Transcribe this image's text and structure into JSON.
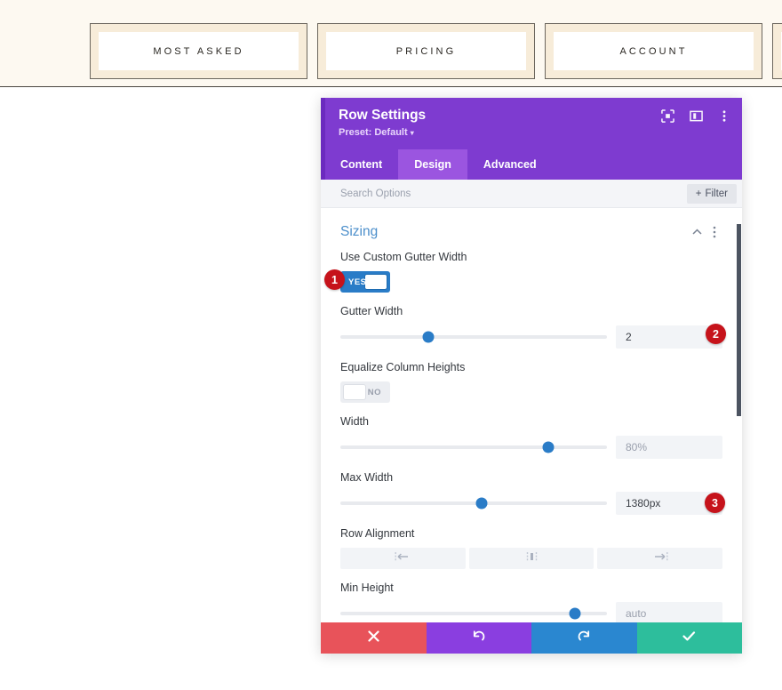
{
  "site": {
    "tabs": [
      {
        "label": "MOST ASKED"
      },
      {
        "label": "PRICING"
      },
      {
        "label": "ACCOUNT"
      },
      {
        "label": ""
      }
    ]
  },
  "modal": {
    "title": "Row Settings",
    "preset_label": "Preset: Default",
    "preset_caret": "▾",
    "header_icons": [
      {
        "name": "focus-target-icon"
      },
      {
        "name": "layout-panel-icon"
      },
      {
        "name": "more-vertical-icon"
      }
    ],
    "tabs": [
      {
        "label": "Content",
        "active": false
      },
      {
        "label": "Design",
        "active": true
      },
      {
        "label": "Advanced",
        "active": false
      }
    ],
    "search": {
      "placeholder": "Search Options",
      "value": ""
    },
    "filter_button": {
      "label": "Filter",
      "plus": "+"
    },
    "section": {
      "title": "Sizing",
      "collapse_icon": "⌃",
      "more_icon": "⋮"
    },
    "fields": {
      "use_custom_gutter_width": {
        "label": "Use Custom Gutter Width",
        "toggle_state": "YES"
      },
      "gutter_width": {
        "label": "Gutter Width",
        "value": "2",
        "slider_percent": 33
      },
      "equalize_column_heights": {
        "label": "Equalize Column Heights",
        "toggle_state": "NO"
      },
      "width": {
        "label": "Width",
        "value": "",
        "placeholder": "80%",
        "slider_percent": 78
      },
      "max_width": {
        "label": "Max Width",
        "value": "1380px",
        "slider_percent": 53
      },
      "row_alignment": {
        "label": "Row Alignment",
        "options": [
          {
            "name": "align-left",
            "icon": "align-left-icon"
          },
          {
            "name": "align-center",
            "icon": "align-center-icon"
          },
          {
            "name": "align-right",
            "icon": "align-right-icon"
          }
        ]
      },
      "min_height": {
        "label": "Min Height",
        "value": "",
        "placeholder": "auto",
        "slider_percent": 88
      }
    },
    "actions": [
      {
        "name": "cancel",
        "icon": "close-icon",
        "color": "#e8535a"
      },
      {
        "name": "undo",
        "icon": "undo-icon",
        "color": "#8a3ee0"
      },
      {
        "name": "redo",
        "icon": "redo-icon",
        "color": "#2a87d0"
      },
      {
        "name": "save",
        "icon": "check-icon",
        "color": "#2dbe9c"
      }
    ]
  },
  "annotations": [
    {
      "number": "1"
    },
    {
      "number": "2"
    },
    {
      "number": "3"
    }
  ]
}
